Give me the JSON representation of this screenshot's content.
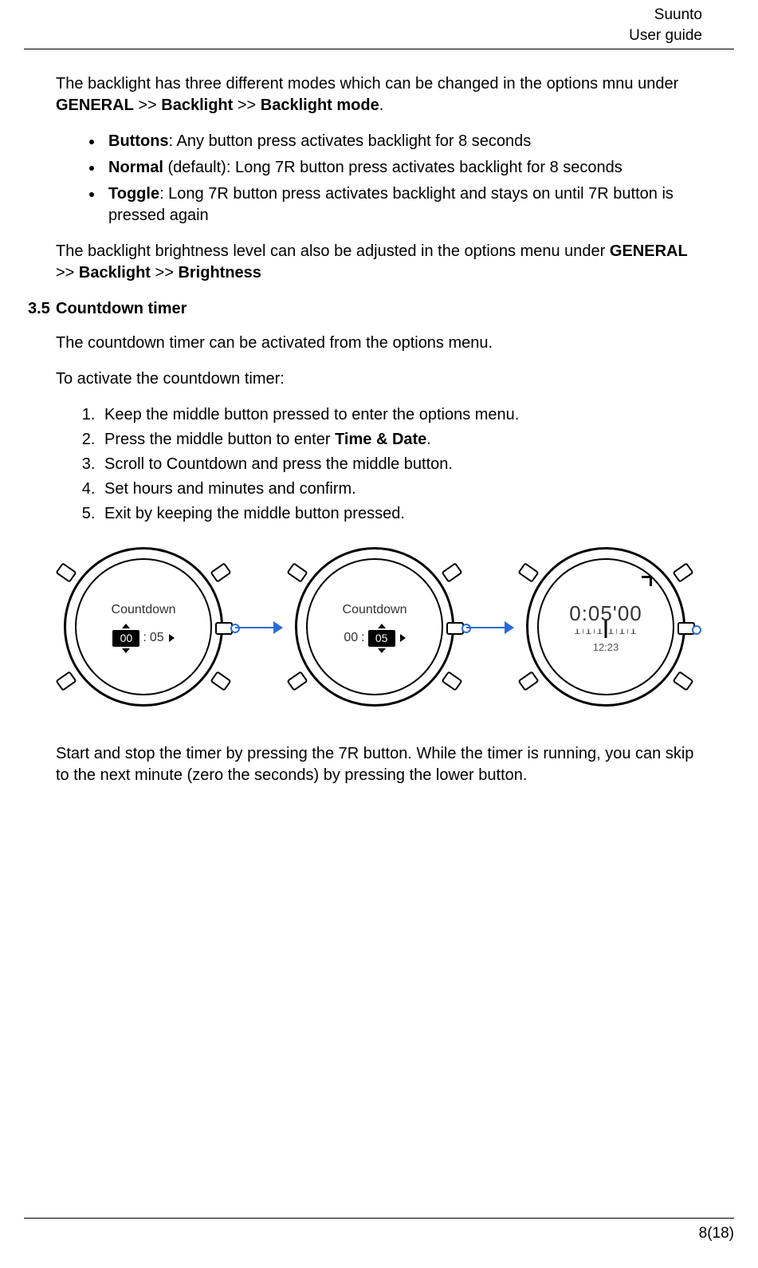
{
  "header": {
    "brand": "Suunto",
    "subtitle": "User guide"
  },
  "body": {
    "p1a": "The backlight has three different modes which can be changed in the options mnu under ",
    "p1b": "GENERAL",
    "p1c": " >> ",
    "p1d": "Backlight",
    "p1e": " >> ",
    "p1f": "Backlight mode",
    "p1g": ".",
    "bullets": [
      {
        "term": "Buttons",
        "rest": ": Any button press activates backlight for 8 seconds"
      },
      {
        "term": "Normal",
        "rest": " (default): Long 7R button press activates backlight for 8 seconds"
      },
      {
        "term": "Toggle",
        "rest": ": Long 7R button press activates backlight and stays on until 7R button is pressed again"
      }
    ],
    "p2a": "The backlight brightness level can also be adjusted in the options menu under ",
    "p2b": "GENERAL",
    "p2c": " >> ",
    "p2d": "Backlight",
    "p2e": " >> ",
    "p2f": "Brightness",
    "h35num": "3.5",
    "h35title": "Countdown timer",
    "p3": "The countdown timer can be activated from the options menu.",
    "p4": "To activate the countdown timer:",
    "steps": [
      "Keep the middle button pressed to enter the options menu.",
      {
        "pre": "Press the middle button to enter ",
        "b": "Time & Date",
        "post": "."
      },
      "Scroll to Countdown and press the middle button.",
      "Set hours and minutes and confirm.",
      "Exit by keeping the middle button pressed."
    ],
    "p5": "Start and stop the timer by pressing the 7R button. While the timer is running, you can skip to the next minute (zero the seconds) by pressing the lower button."
  },
  "figure": {
    "watch1": {
      "title": "Countdown",
      "hh": "00",
      "mm": "05"
    },
    "watch2": {
      "title": "Countdown",
      "hh": "00",
      "mm": "05"
    },
    "watch3": {
      "time": "0:05'00",
      "sub": "12:23"
    }
  },
  "footer": {
    "page": "8(18)"
  }
}
